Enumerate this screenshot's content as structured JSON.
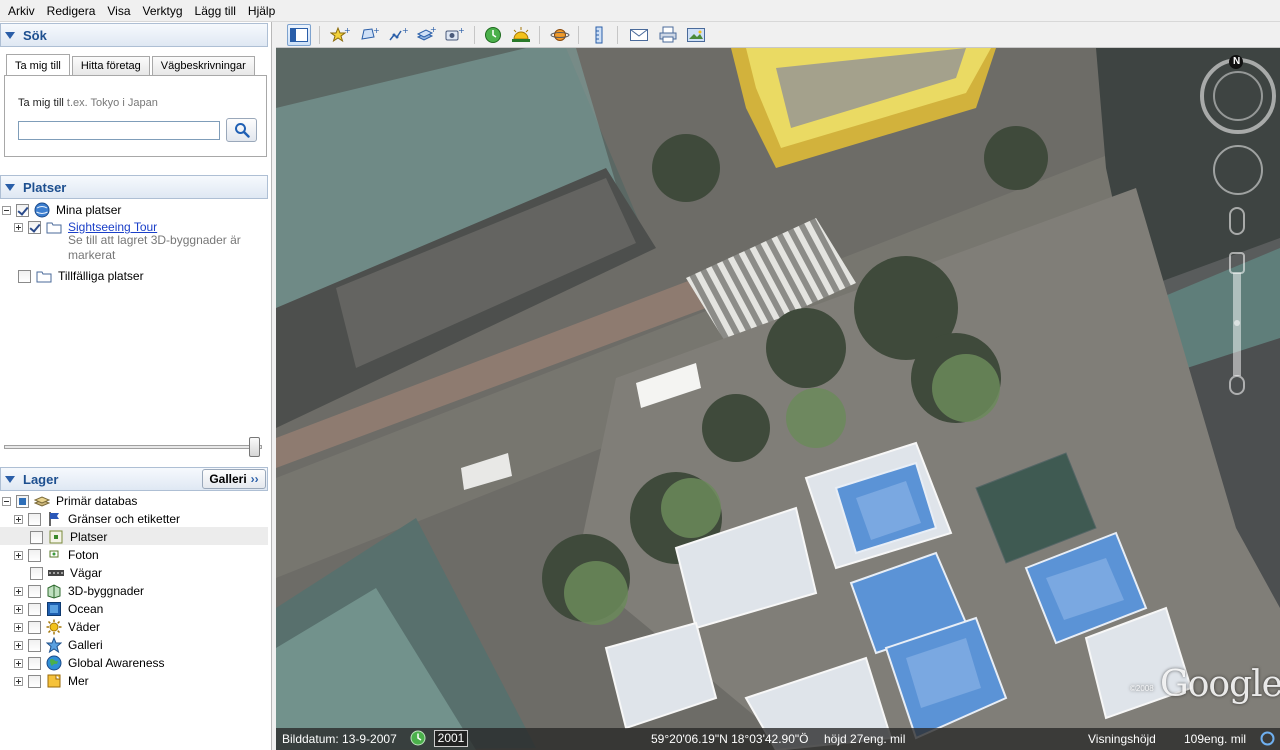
{
  "menu": [
    "Arkiv",
    "Redigera",
    "Visa",
    "Verktyg",
    "Lägg till",
    "Hjälp"
  ],
  "search": {
    "header": "Sök",
    "tabs": [
      "Ta mig till",
      "Hitta företag",
      "Vägbeskrivningar"
    ],
    "label": "Ta mig till",
    "placeholder_hint": "t.ex. Tokyo i Japan",
    "value": ""
  },
  "places": {
    "header": "Platser",
    "my_places": "Mina platser",
    "tour": "Sightseeing Tour",
    "tour_desc": "Se till att lagret 3D-byggnader är markerat",
    "temp": "Tillfälliga platser"
  },
  "layers": {
    "header": "Lager",
    "gallery_button": "Galleri",
    "primary": "Primär databas",
    "items": [
      "Gränser och etiketter",
      "Platser",
      "Foton",
      "Vägar",
      "3D-byggnader",
      "Ocean",
      "Väder",
      "Galleri",
      "Global Awareness",
      "Mer"
    ]
  },
  "status": {
    "date_label": "Bilddatum: 13-9-2007",
    "year": "2001",
    "coords": "59°20'06.19\"N   18°03'42.90\"Ö",
    "elev": "höjd   27eng. mil",
    "eye_label": "Visningshöjd",
    "eye_value": "109eng. mil"
  },
  "map": {
    "compass_north": "N",
    "logo": "Google",
    "copyright": "©2008"
  }
}
